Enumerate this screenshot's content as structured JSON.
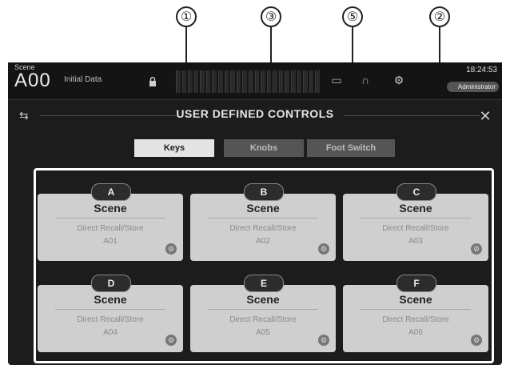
{
  "callouts": [
    "①",
    "③",
    "⑤",
    "②"
  ],
  "topbar": {
    "scene_small": "Scene",
    "scene_number": "A00",
    "scene_title": "Initial Data",
    "clock": "18:24:53",
    "user": "Administrator"
  },
  "page": {
    "title": "USER DEFINED CONTROLS",
    "back_icon": "back-icon",
    "close_symbol": "✕"
  },
  "tabs": [
    {
      "label": "Keys",
      "state": "active"
    },
    {
      "label": "Knobs",
      "state": "inactive"
    },
    {
      "label": "Foot Switch",
      "state": "inactive"
    }
  ],
  "keys": [
    {
      "badge": "A",
      "function": "Scene",
      "parameter": "Direct Recall/Store",
      "value": "A01"
    },
    {
      "badge": "B",
      "function": "Scene",
      "parameter": "Direct Recall/Store",
      "value": "A02"
    },
    {
      "badge": "C",
      "function": "Scene",
      "parameter": "Direct Recall/Store",
      "value": "A03"
    },
    {
      "badge": "D",
      "function": "Scene",
      "parameter": "Direct Recall/Store",
      "value": "A04"
    },
    {
      "badge": "E",
      "function": "Scene",
      "parameter": "Direct Recall/Store",
      "value": "A05"
    },
    {
      "badge": "F",
      "function": "Scene",
      "parameter": "Direct Recall/Store",
      "value": "A06"
    }
  ],
  "colors": {
    "screen_bg": "#1c1c1c",
    "key_bg": "#cfcfcf",
    "tab_active": "#e4e4e4",
    "tab_inactive": "#555555"
  }
}
